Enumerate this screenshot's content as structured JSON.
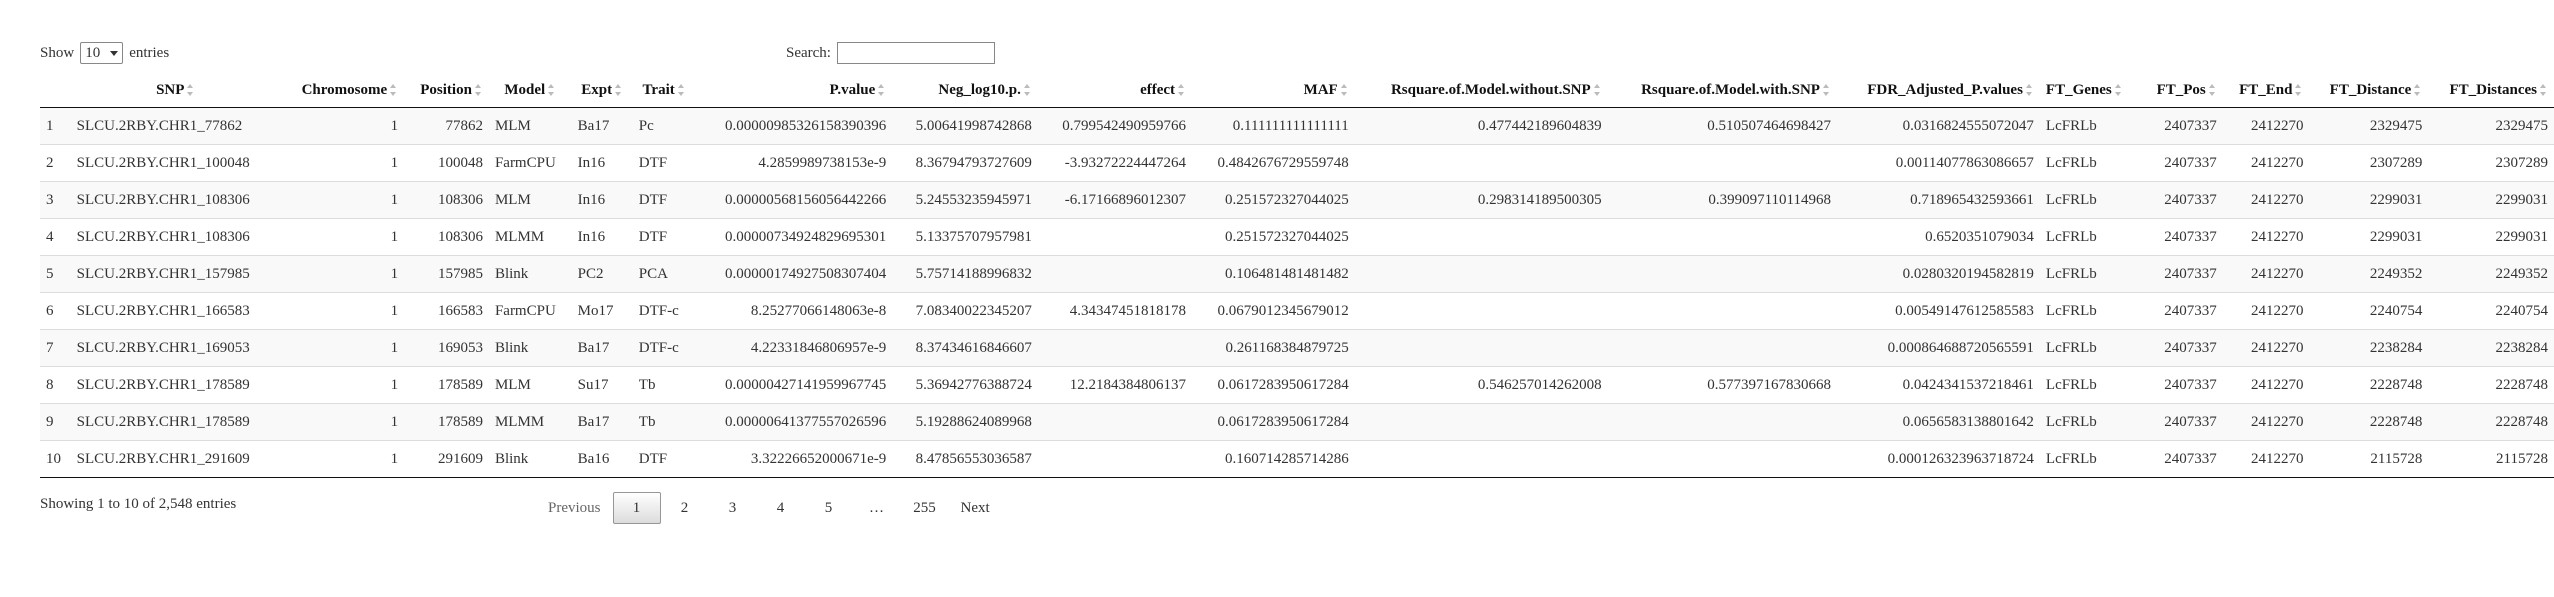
{
  "controls": {
    "show_label": "Show",
    "entries_value": "10",
    "entries_label": "entries",
    "search_label": "Search:",
    "search_value": ""
  },
  "table": {
    "columns": [
      "",
      "SNP",
      "Chromosome",
      "Position",
      "Model",
      "Expt",
      "Trait",
      "P.value",
      "Neg_log10.p.",
      "effect",
      "MAF",
      "Rsquare.of.Model.without.SNP",
      "Rsquare.of.Model.with.SNP",
      "FDR_Adjusted_P.values",
      "FT_Genes",
      "FT_Pos",
      "FT_End",
      "FT_Distance",
      "FT_Distances"
    ],
    "rows": [
      [
        "1",
        "SLCU.2RBY.CHR1_77862",
        "1",
        "77862",
        "MLM",
        "Ba17",
        "Pc",
        "0.00000985326158390396",
        "5.00641998742868",
        "0.799542490959766",
        "0.111111111111111",
        "0.477442189604839",
        "0.510507464698427",
        "0.0316824555072047",
        "LcFRLb",
        "2407337",
        "2412270",
        "2329475",
        "2329475"
      ],
      [
        "2",
        "SLCU.2RBY.CHR1_100048",
        "1",
        "100048",
        "FarmCPU",
        "In16",
        "DTF",
        "4.2859989738153e-9",
        "8.36794793727609",
        "-3.93272224447264",
        "0.484267672955974​8",
        "",
        "",
        "0.00114077863086657",
        "LcFRLb",
        "2407337",
        "2412270",
        "2307289",
        "2307289"
      ],
      [
        "3",
        "SLCU.2RBY.CHR1_108306",
        "1",
        "108306",
        "MLM",
        "In16",
        "DTF",
        "0.00000568156056442266",
        "5.24553235945971",
        "-6.17166896012307",
        "0.251572327044025",
        "0.298314189500305",
        "0.399097110114968",
        "0.718965432593661",
        "LcFRLb",
        "2407337",
        "2412270",
        "2299031",
        "2299031"
      ],
      [
        "4",
        "SLCU.2RBY.CHR1_108306",
        "1",
        "108306",
        "MLMM",
        "In16",
        "DTF",
        "0.00000734924829695301",
        "5.13375707957981",
        "",
        "0.251572327044025",
        "",
        "",
        "0.6520351079034",
        "LcFRLb",
        "2407337",
        "2412270",
        "2299031",
        "2299031"
      ],
      [
        "5",
        "SLCU.2RBY.CHR1_157985",
        "1",
        "157985",
        "Blink",
        "PC2",
        "PCA",
        "0.00000174927508307404",
        "5.75714188996832",
        "",
        "0.106481481481482",
        "",
        "",
        "0.0280320194582819",
        "LcFRLb",
        "2407337",
        "2412270",
        "2249352",
        "2249352"
      ],
      [
        "6",
        "SLCU.2RBY.CHR1_166583",
        "1",
        "166583",
        "FarmCPU",
        "Mo17",
        "DTF-c",
        "8.25277066148063e-8",
        "7.08340022345207",
        "4.34347451818178",
        "0.0679012345679012",
        "",
        "",
        "0.00549147612585583",
        "LcFRLb",
        "2407337",
        "2412270",
        "2240754",
        "2240754"
      ],
      [
        "7",
        "SLCU.2RBY.CHR1_169053",
        "1",
        "169053",
        "Blink",
        "Ba17",
        "DTF-c",
        "4.22331846806957e-9",
        "8.37434616846607",
        "",
        "0.261168384879725",
        "",
        "",
        "0.000864688720565591",
        "LcFRLb",
        "2407337",
        "2412270",
        "2238284",
        "2238284"
      ],
      [
        "8",
        "SLCU.2RBY.CHR1_178589",
        "1",
        "178589",
        "MLM",
        "Su17",
        "Tb",
        "0.00000427141959967745",
        "5.36942776388724",
        "12.2184384806137",
        "0.0617283950617284",
        "0.546257014262008",
        "0.577397167830668",
        "0.0424341537218461",
        "LcFRLb",
        "2407337",
        "2412270",
        "2228748",
        "2228748"
      ],
      [
        "9",
        "SLCU.2RBY.CHR1_178589",
        "1",
        "178589",
        "MLMM",
        "Ba17",
        "Tb",
        "0.00000641377557026596",
        "5.19288624089968",
        "",
        "0.0617283950617284",
        "",
        "",
        "0.0656583138801642",
        "LcFRLb",
        "2407337",
        "2412270",
        "2228748",
        "2228748"
      ],
      [
        "10",
        "SLCU.2RBY.CHR1_291609",
        "1",
        "291609",
        "Blink",
        "Ba16",
        "DTF",
        "3.32226652000671e-9",
        "8.47856553036587",
        "",
        "0.160714285714286",
        "",
        "",
        "0.000126323963718724",
        "LcFRLb",
        "2407337",
        "2412270",
        "2115728",
        "2115728"
      ]
    ]
  },
  "footer": {
    "info": "Showing 1 to 10 of 2,548 entries",
    "previous": "Previous",
    "pages": [
      "1",
      "2",
      "3",
      "4",
      "5",
      "…",
      "255"
    ],
    "current_page": "1",
    "next": "Next"
  }
}
